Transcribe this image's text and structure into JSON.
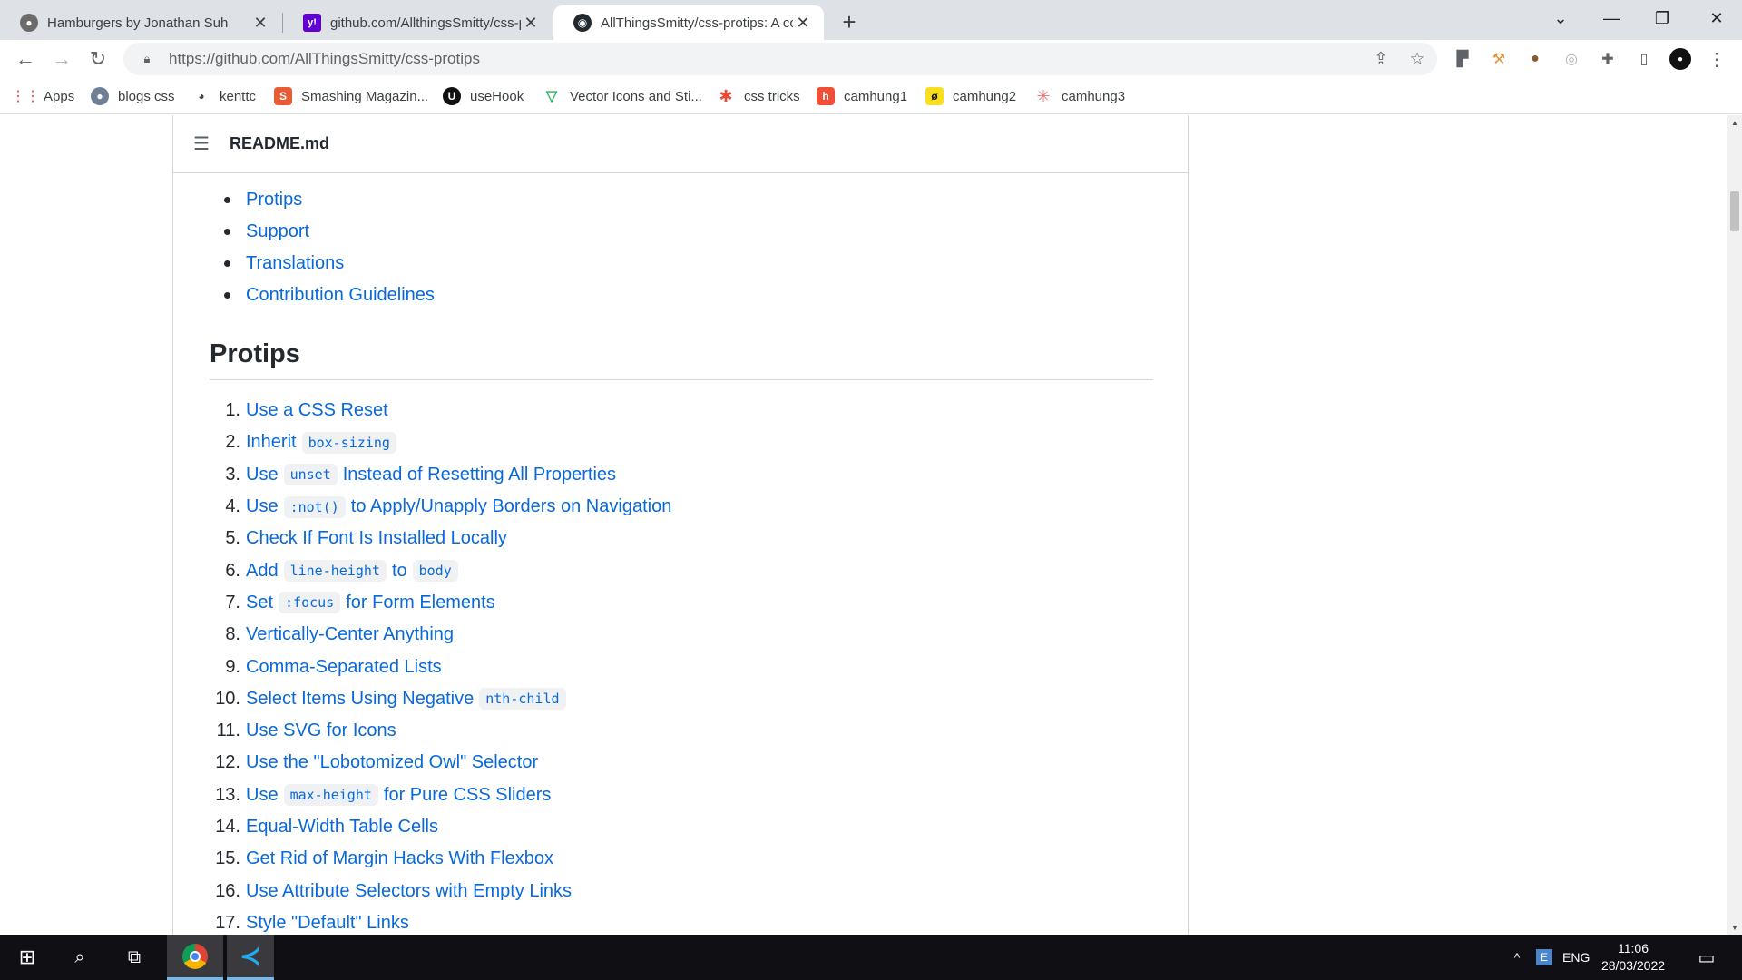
{
  "browser": {
    "tabs": [
      {
        "title": "Hamburgers by Jonathan Suh",
        "active": false
      },
      {
        "title": "github.com/AllthingsSmitty/css-p",
        "active": false
      },
      {
        "title": "AllThingsSmitty/css-protips: A co",
        "active": true
      }
    ],
    "new_tab": "+",
    "url": "https://github.com/AllThingsSmitty/css-protips",
    "bookmarks": [
      {
        "label": "Apps"
      },
      {
        "label": "blogs css"
      },
      {
        "label": "kenttc"
      },
      {
        "label": "Smashing Magazin..."
      },
      {
        "label": "useHook"
      },
      {
        "label": "Vector Icons and Sti..."
      },
      {
        "label": "css tricks"
      },
      {
        "label": "camhung1"
      },
      {
        "label": "camhung2"
      },
      {
        "label": "camhung3"
      }
    ]
  },
  "readme": {
    "filename": "README.md",
    "toc_items": [
      "Protips",
      "Support",
      "Translations",
      "Contribution Guidelines"
    ],
    "heading": "Protips",
    "protips": [
      {
        "num": "1.",
        "parts": [
          {
            "t": "Use a CSS Reset"
          }
        ]
      },
      {
        "num": "2.",
        "parts": [
          {
            "t": "Inherit"
          },
          {
            "code": "box-sizing"
          }
        ]
      },
      {
        "num": "3.",
        "parts": [
          {
            "t": "Use"
          },
          {
            "code": "unset"
          },
          {
            "t": "Instead of Resetting All Properties"
          }
        ]
      },
      {
        "num": "4.",
        "parts": [
          {
            "t": "Use"
          },
          {
            "code": ":not()"
          },
          {
            "t": "to Apply/Unapply Borders on Navigation"
          }
        ]
      },
      {
        "num": "5.",
        "parts": [
          {
            "t": "Check If Font Is Installed Locally"
          }
        ]
      },
      {
        "num": "6.",
        "parts": [
          {
            "t": "Add"
          },
          {
            "code": "line-height"
          },
          {
            "t": "to"
          },
          {
            "code": "body"
          }
        ]
      },
      {
        "num": "7.",
        "parts": [
          {
            "t": "Set"
          },
          {
            "code": ":focus"
          },
          {
            "t": "for Form Elements"
          }
        ]
      },
      {
        "num": "8.",
        "parts": [
          {
            "t": "Vertically-Center Anything"
          }
        ]
      },
      {
        "num": "9.",
        "parts": [
          {
            "t": "Comma-Separated Lists"
          }
        ]
      },
      {
        "num": "10.",
        "parts": [
          {
            "t": "Select Items Using Negative"
          },
          {
            "code": "nth-child"
          }
        ]
      },
      {
        "num": "11.",
        "parts": [
          {
            "t": "Use SVG for Icons"
          }
        ]
      },
      {
        "num": "12.",
        "parts": [
          {
            "t": "Use the \"Lobotomized Owl\" Selector"
          }
        ]
      },
      {
        "num": "13.",
        "parts": [
          {
            "t": "Use"
          },
          {
            "code": "max-height"
          },
          {
            "t": "for Pure CSS Sliders"
          }
        ]
      },
      {
        "num": "14.",
        "parts": [
          {
            "t": "Equal-Width Table Cells"
          }
        ]
      },
      {
        "num": "15.",
        "parts": [
          {
            "t": "Get Rid of Margin Hacks With Flexbox"
          }
        ]
      },
      {
        "num": "16.",
        "parts": [
          {
            "t": "Use Attribute Selectors with Empty Links"
          }
        ]
      },
      {
        "num": "17.",
        "parts": [
          {
            "t": "Style \"Default\" Links"
          }
        ]
      }
    ]
  },
  "taskbar": {
    "language": "ENG",
    "time": "11:06",
    "date": "28/03/2022"
  },
  "colors": {
    "link": "#0969da",
    "text": "#24292f",
    "tabstrip": "#dee1e6",
    "taskbar": "#101014"
  }
}
